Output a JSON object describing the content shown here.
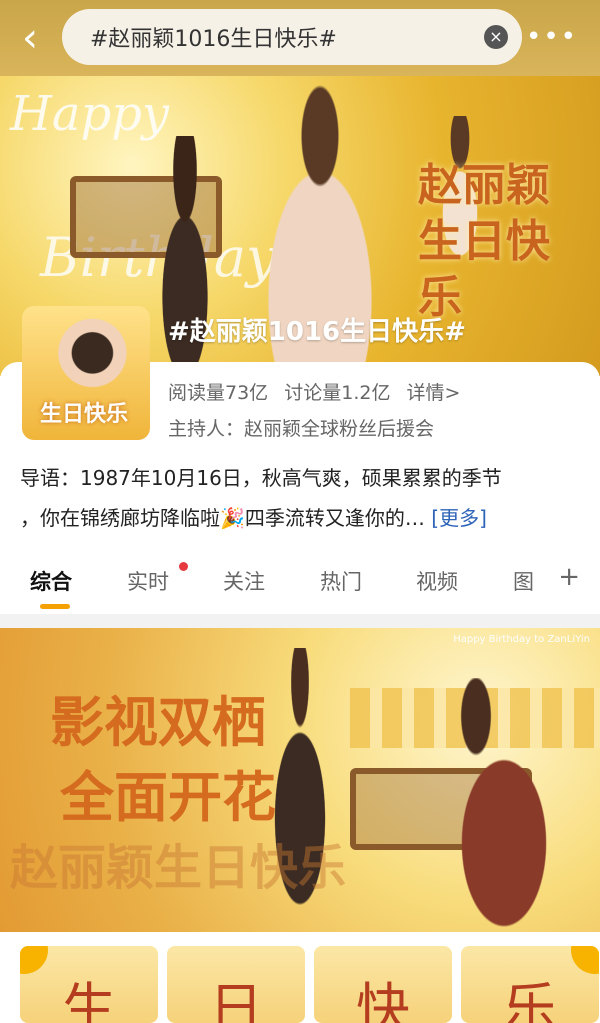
{
  "search": {
    "text": "#赵丽颖1016生日快乐#"
  },
  "hero": {
    "script_line1": "Happy",
    "script_line2": "Birthday",
    "title_line1": "赵丽颖",
    "title_line2": "生日快乐"
  },
  "topic": {
    "title": "#赵丽颖1016生日快乐#",
    "thumb_text": "生日快乐",
    "reads": "阅读量73亿",
    "discussions": "讨论量1.2亿",
    "details": "详情>",
    "host": "主持人：赵丽颖全球粉丝后援会",
    "intro_line1": "导语：1987年10月16日，秋高气爽，硕果累累的季节",
    "intro_line2": "，你在锦绣廊坊降临啦🎉四季流转又逢你的…",
    "more": "[更多]"
  },
  "tabs": [
    "综合",
    "实时",
    "关注",
    "热门",
    "视频",
    "图"
  ],
  "banner": {
    "line1": "影视双栖",
    "line2": "全面开花",
    "watermark": "赵丽颖生日快乐",
    "caption": "Happy Birthday to ZanLiYin"
  },
  "stamps": [
    "生",
    "日",
    "快",
    "乐"
  ],
  "colors": {
    "accent": "#f4a100",
    "link": "#2e64b8",
    "dot": "#e6393f"
  }
}
